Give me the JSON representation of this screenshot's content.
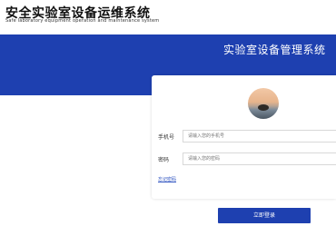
{
  "header": {
    "title": "安全实验室设备运维系统",
    "subtitle": "Safe laboratory equipment operation and maintenance system"
  },
  "banner": {
    "system_title": "实验室设备管理系统"
  },
  "login": {
    "phone_label": "手机号",
    "phone_placeholder": "请输入您的手机号",
    "password_label": "密码",
    "password_placeholder": "请输入您的密码",
    "forgot_password": "忘记密码",
    "login_button": "立即登录"
  },
  "colors": {
    "brand_blue": "#1e40b0"
  }
}
